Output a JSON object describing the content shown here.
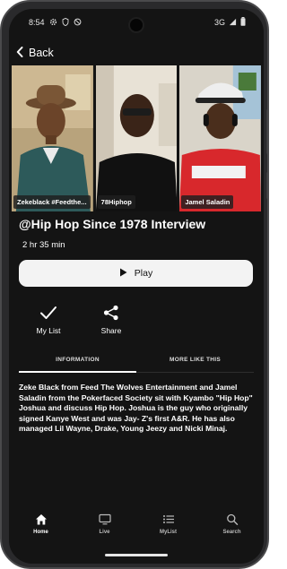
{
  "status_bar": {
    "time": "8:54",
    "network": "3G"
  },
  "topbar": {
    "back_label": "Back"
  },
  "hero": {
    "panels": [
      {
        "label": "Zekeblack #Feedthe..."
      },
      {
        "label": "78Hiphop"
      },
      {
        "label": "Jamel Saladin"
      }
    ]
  },
  "show": {
    "title": "@Hip Hop Since 1978 Interview",
    "duration": "2 hr 35 min",
    "play_label": "Play"
  },
  "actions": {
    "my_list_label": "My List",
    "share_label": "Share"
  },
  "tabs": [
    {
      "label": "INFORMATION",
      "active": true
    },
    {
      "label": "MORE LIKE THIS",
      "active": false
    }
  ],
  "description": "Zeke Black from Feed The Wolves Entertainment and Jamel Saladin from the Pokerfaced Society sit with Kyambo \"Hip Hop\" Joshua and discuss Hip Hop. Joshua is the guy who originally signed Kanye West and was Jay- Z's first A&R. He has also managed Lil Wayne, Drake, Young Jeezy and Nicki Minaj.",
  "bottom_nav": [
    {
      "label": "Home",
      "icon": "home-icon",
      "active": true
    },
    {
      "label": "Live",
      "icon": "tv-icon",
      "active": false
    },
    {
      "label": "MyList",
      "icon": "list-icon",
      "active": false
    },
    {
      "label": "Search",
      "icon": "search-icon",
      "active": false
    }
  ],
  "colors": {
    "background": "#141414",
    "jersey_red": "#d8282c",
    "play_button": "#f3f3f3"
  }
}
